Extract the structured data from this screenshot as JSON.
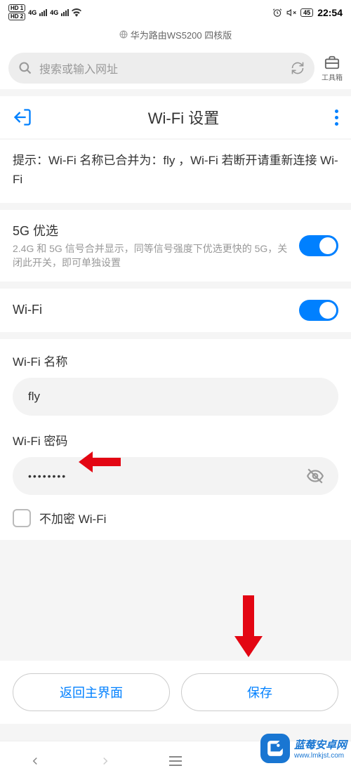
{
  "status": {
    "hd1": "HD 1",
    "hd2": "HD 2",
    "net1": "4G",
    "net2": "4G",
    "battery": "45",
    "time": "22:54"
  },
  "browser": {
    "url_title": "华为路由WS5200 四核版",
    "search_placeholder": "搜索或输入网址",
    "toolbox_label": "工具箱"
  },
  "page": {
    "title": "Wi-Fi 设置",
    "hint": "提示：Wi-Fi 名称已合并为：fly ，Wi-Fi 若断开请重新连接 Wi-Fi",
    "pref5g": {
      "title": "5G 优选",
      "desc": "2.4G 和 5G 信号合并显示，同等信号强度下优选更快的 5G，关闭此开关，即可单独设置"
    },
    "wifi_toggle_label": "Wi-Fi",
    "name_label": "Wi-Fi 名称",
    "name_value": "fly",
    "password_label": "Wi-Fi 密码",
    "password_dots": "••••••••",
    "no_encrypt_label": "不加密 Wi-Fi",
    "back_btn": "返回主界面",
    "save_btn": "保存"
  },
  "watermark": {
    "title": "蓝莓安卓网",
    "url": "www.lmkjst.com"
  }
}
